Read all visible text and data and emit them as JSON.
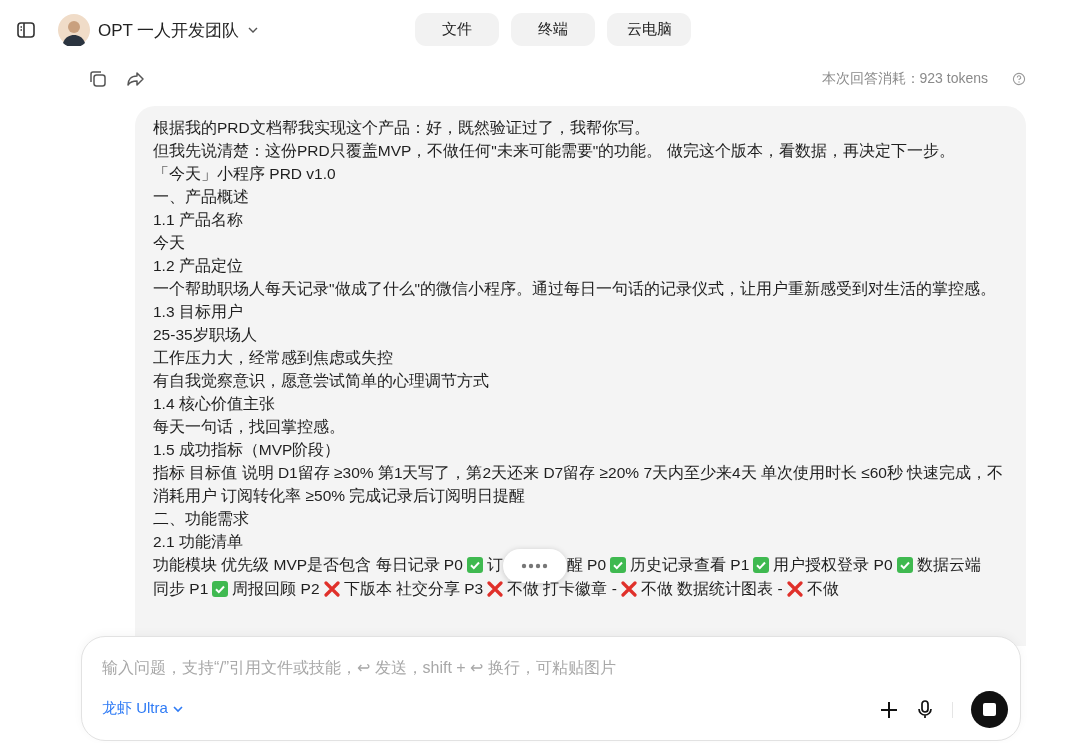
{
  "header": {
    "team_name": "OPT 一人开发团队",
    "tabs": [
      {
        "label": "文件"
      },
      {
        "label": "终端"
      },
      {
        "label": "云电脑"
      }
    ]
  },
  "reply_bar": {
    "usage": "本次回答消耗：923 tokens"
  },
  "message": {
    "paragraphs": [
      {
        "segments": [
          {
            "kind": "text",
            "text": "根据我的PRD文档帮我实现这个产品：好，既然验证过了，我帮你写。"
          }
        ]
      },
      {
        "segments": [
          {
            "kind": "text",
            "text": "但我先说清楚：这份PRD只覆盖MVP，不做任何\"未来可能需要\"的功能。 做完这个版本，看数据，再决定下一步。"
          }
        ]
      },
      {
        "segments": [
          {
            "kind": "text",
            "text": "「今天」小程序 PRD v1.0"
          }
        ]
      },
      {
        "segments": [
          {
            "kind": "text",
            "text": "一、产品概述"
          }
        ]
      },
      {
        "segments": [
          {
            "kind": "text",
            "text": "1.1 产品名称"
          }
        ]
      },
      {
        "segments": [
          {
            "kind": "text",
            "text": "今天"
          }
        ]
      },
      {
        "segments": [
          {
            "kind": "text",
            "text": "1.2 产品定位"
          }
        ]
      },
      {
        "segments": [
          {
            "kind": "text",
            "text": "一个帮助职场人每天记录\"做成了什么\"的微信小程序。通过每日一句话的记录仪式，让用户重新感受到对生活的掌控感。"
          }
        ]
      },
      {
        "segments": [
          {
            "kind": "text",
            "text": "1.3 目标用户"
          }
        ]
      },
      {
        "segments": [
          {
            "kind": "text",
            "text": "25-35岁职场人"
          }
        ]
      },
      {
        "segments": [
          {
            "kind": "text",
            "text": "工作压力大，经常感到焦虑或失控"
          }
        ]
      },
      {
        "segments": [
          {
            "kind": "text",
            "text": "有自我觉察意识，愿意尝试简单的心理调节方式"
          }
        ]
      },
      {
        "segments": [
          {
            "kind": "text",
            "text": "1.4 核心价值主张"
          }
        ]
      },
      {
        "segments": [
          {
            "kind": "text",
            "text": "每天一句话，找回掌控感。"
          }
        ]
      },
      {
        "segments": [
          {
            "kind": "text",
            "text": "1.5 成功指标（MVP阶段）"
          }
        ]
      },
      {
        "segments": [
          {
            "kind": "text",
            "text": "指标 目标值 说明 D1留存 ≥30% 第1天写了，第2天还来 D7留存 ≥20% 7天内至少来4天 单次使用时长 ≤60秒 快速完成，不消耗用户 订阅转化率 ≥50% 完成记录后订阅明日提醒"
          }
        ]
      },
      {
        "segments": [
          {
            "kind": "text",
            "text": "二、功能需求"
          }
        ]
      },
      {
        "segments": [
          {
            "kind": "text",
            "text": "2.1 功能清单"
          }
        ]
      },
      {
        "segments": [
          {
            "kind": "text",
            "text": "功能模块 优先级 MVP是否包含 每日记录 P0"
          },
          {
            "kind": "check"
          },
          {
            "kind": "text",
            "text": "订"
          },
          {
            "kind": "handle"
          },
          {
            "kind": "text",
            "text": "醒 P0"
          },
          {
            "kind": "check"
          },
          {
            "kind": "text",
            "text": "历史记录查看 P1"
          },
          {
            "kind": "check"
          },
          {
            "kind": "text",
            "text": "用户授权登录 P0"
          },
          {
            "kind": "check"
          },
          {
            "kind": "text",
            "text": "数据云端"
          },
          {
            "kind": "text",
            "text": "同步 P1"
          },
          {
            "kind": "check"
          },
          {
            "kind": "text",
            "text": "周报回顾 P2"
          },
          {
            "kind": "cross"
          },
          {
            "kind": "text",
            "text": "下版本 社交分享 P3"
          },
          {
            "kind": "cross"
          },
          {
            "kind": "text",
            "text": "不做 打卡徽章 -"
          },
          {
            "kind": "cross"
          },
          {
            "kind": "text",
            "text": "不做 数据统计图表 -"
          },
          {
            "kind": "cross"
          },
          {
            "kind": "text",
            "text": "不做"
          }
        ]
      }
    ]
  },
  "composer": {
    "placeholder": "输入问题，支持“/”引用文件或技能，↩ 发送，shift + ↩ 换行，可粘贴图片",
    "model": "龙虾 Ultra"
  }
}
